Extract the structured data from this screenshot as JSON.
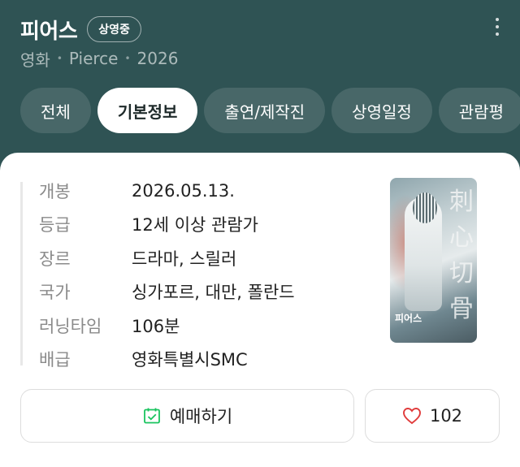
{
  "header": {
    "title": "피어스",
    "badge": "상영중",
    "subtitle": {
      "genre": "영화",
      "english_title": "Pierce",
      "year": "2026"
    },
    "more_icon": "more-vertical-icon"
  },
  "tabs": [
    {
      "label": "전체",
      "active": false
    },
    {
      "label": "기본정보",
      "active": true
    },
    {
      "label": "출연/제작진",
      "active": false
    },
    {
      "label": "상영일정",
      "active": false
    },
    {
      "label": "관람평",
      "active": false
    }
  ],
  "info": [
    {
      "label": "개봉",
      "value": "2026.05.13."
    },
    {
      "label": "등급",
      "value": "12세 이상 관람가"
    },
    {
      "label": "장르",
      "value": "드라마, 스릴러"
    },
    {
      "label": "국가",
      "value": "싱가포르, 대만, 폴란드"
    },
    {
      "label": "러닝타임",
      "value": "106분"
    },
    {
      "label": "배급",
      "value": "영화특별시SMC"
    }
  ],
  "poster": {
    "calligraphy": "刺心切骨",
    "title": "피어스"
  },
  "actions": {
    "reserve_label": "예매하기",
    "like_count": "102"
  },
  "colors": {
    "header_bg": "#2f5354",
    "accent_green": "#19c45f",
    "heart_red": "#e03a3a"
  }
}
